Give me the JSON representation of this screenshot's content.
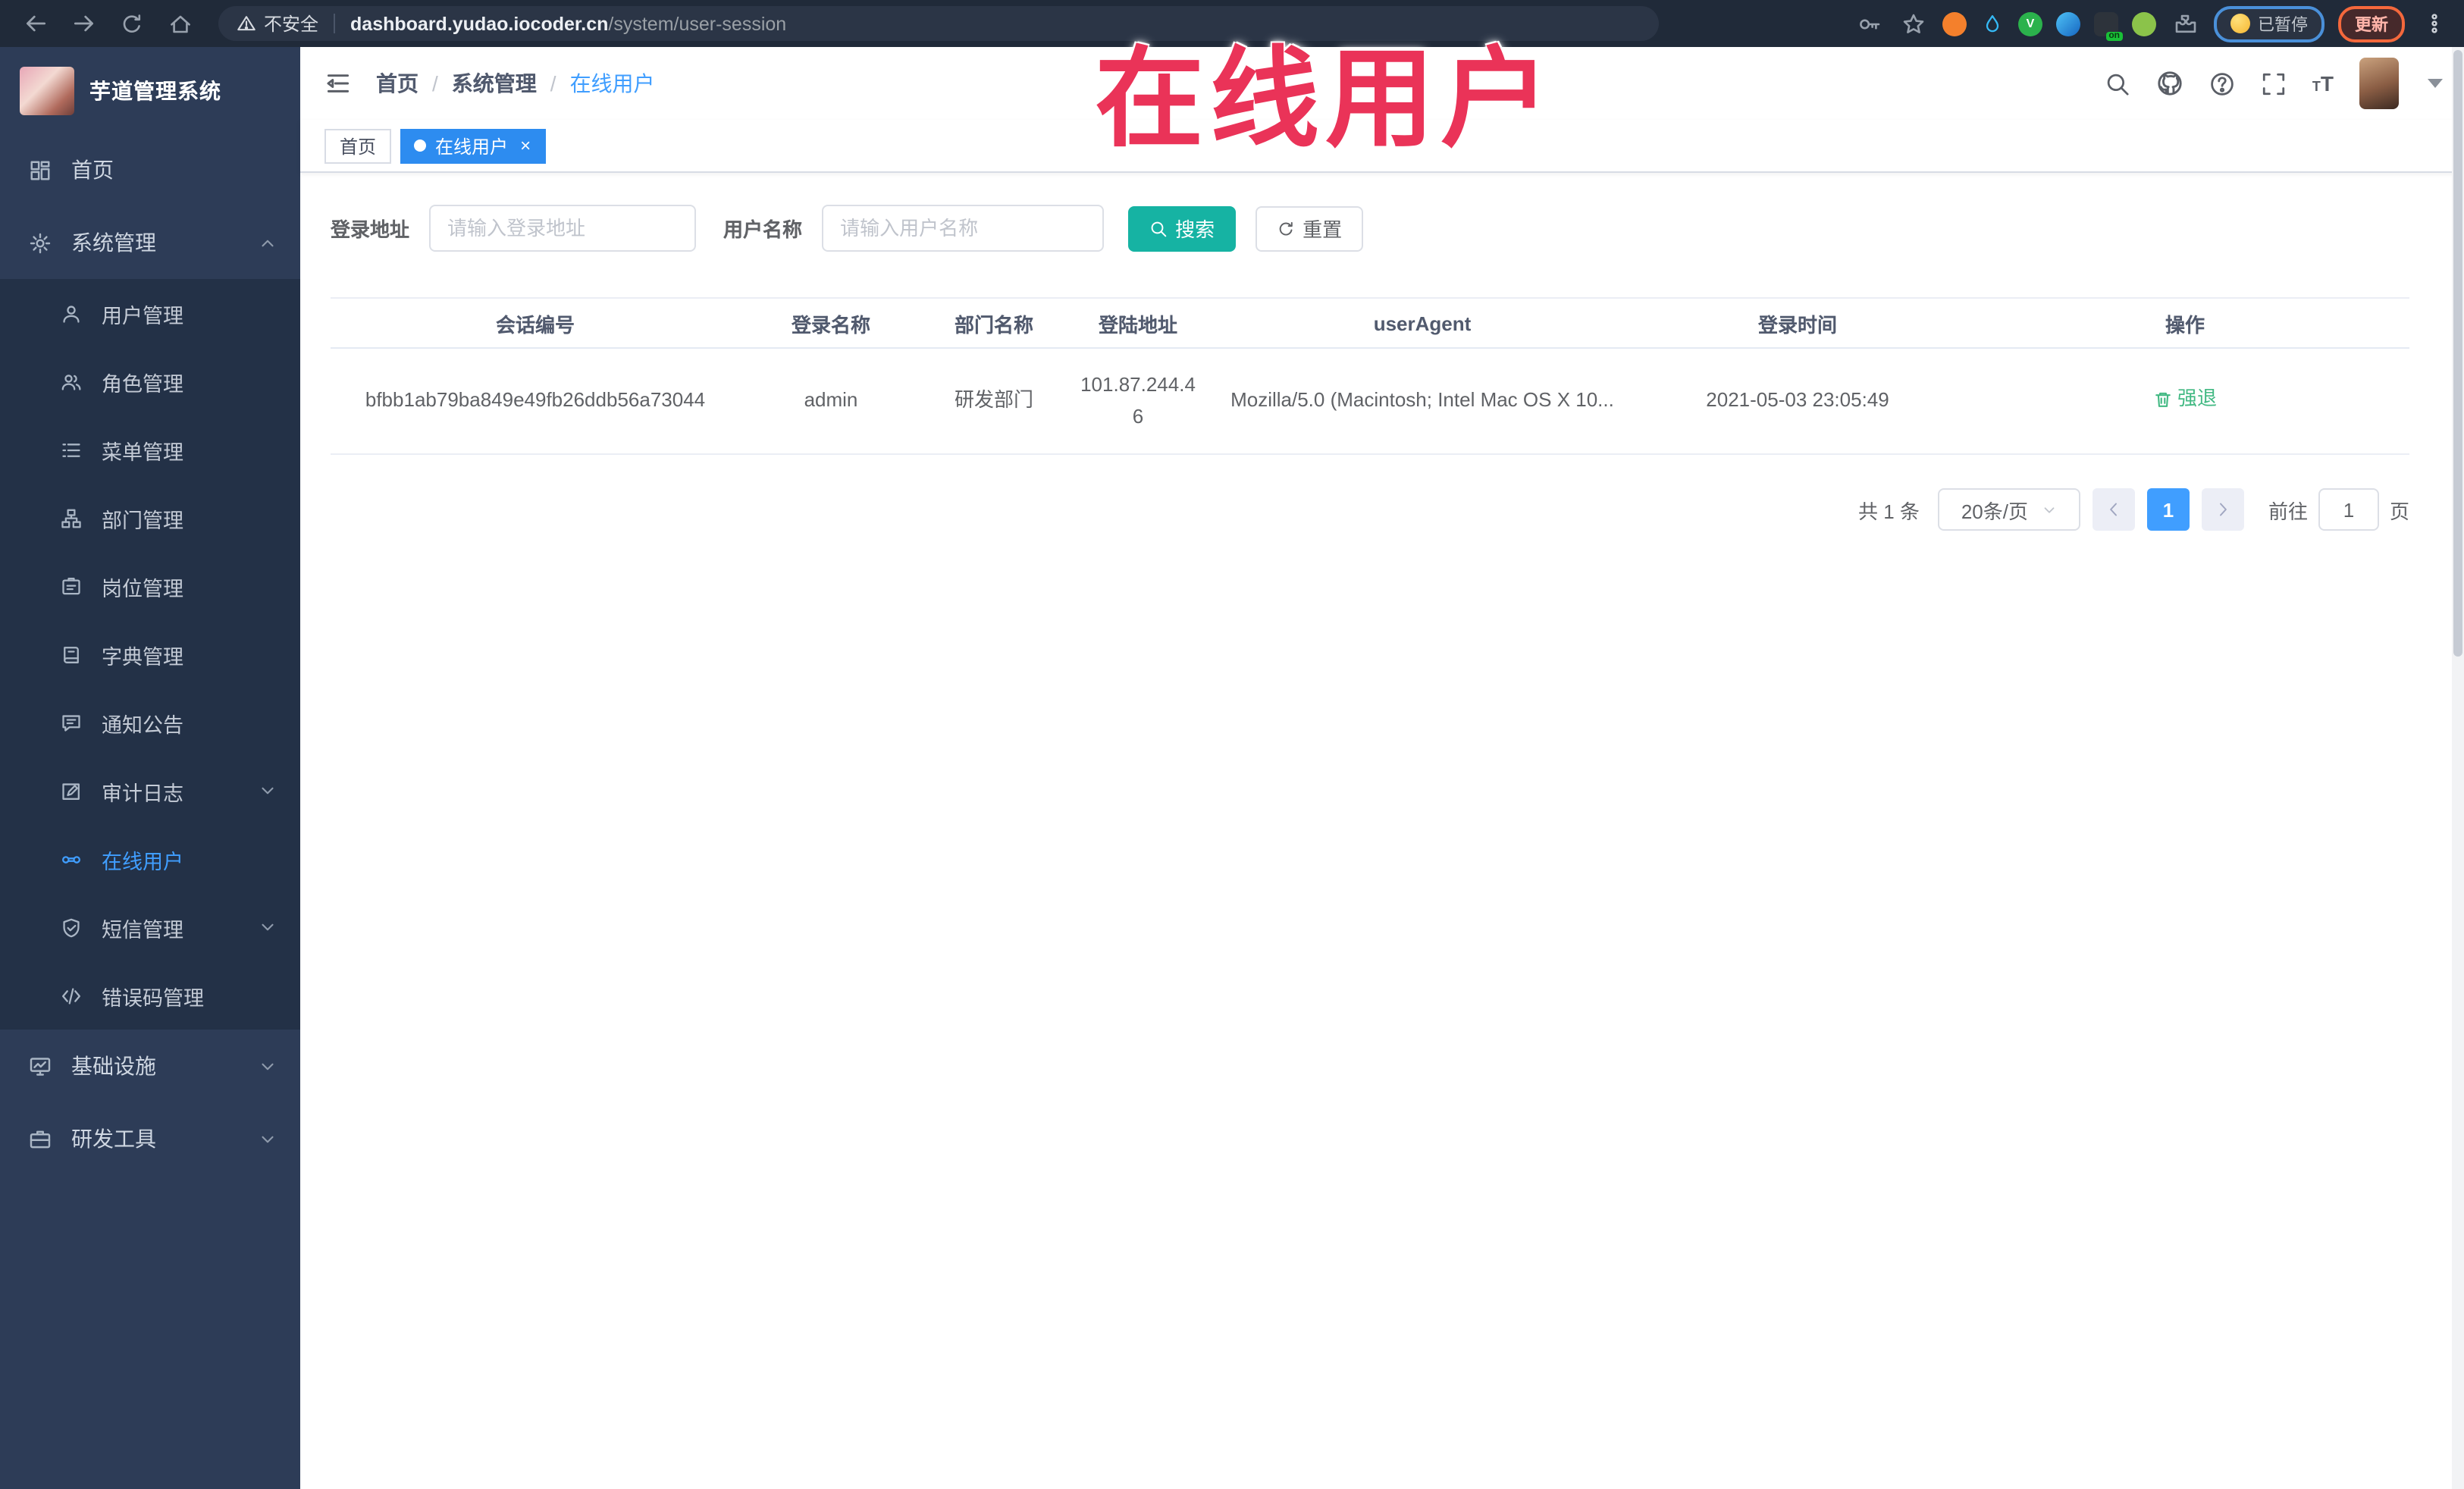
{
  "browser": {
    "security_label": "不安全",
    "url_domain": "dashboard.yudao.iocoder.cn",
    "url_path": "/system/user-session",
    "paused_badge_label": "已暂停",
    "update_button_label": "更新"
  },
  "sidebar": {
    "logo_title": "芋道管理系统",
    "items": [
      {
        "label": "首页"
      },
      {
        "label": "系统管理"
      }
    ],
    "submenu": [
      {
        "label": "用户管理"
      },
      {
        "label": "角色管理"
      },
      {
        "label": "菜单管理"
      },
      {
        "label": "部门管理"
      },
      {
        "label": "岗位管理"
      },
      {
        "label": "字典管理"
      },
      {
        "label": "通知公告"
      },
      {
        "label": "审计日志"
      },
      {
        "label": "在线用户"
      },
      {
        "label": "短信管理"
      },
      {
        "label": "错误码管理"
      }
    ],
    "bottom_items": [
      {
        "label": "基础设施"
      },
      {
        "label": "研发工具"
      }
    ]
  },
  "header": {
    "breadcrumb": [
      {
        "label": "首页"
      },
      {
        "label": "系统管理"
      },
      {
        "label": "在线用户"
      }
    ]
  },
  "tags_view": {
    "tabs": [
      {
        "label": "首页"
      },
      {
        "label": "在线用户"
      }
    ]
  },
  "overlay": {
    "title": "在线用户"
  },
  "filters": {
    "login_address_label": "登录地址",
    "login_address_placeholder": "请输入登录地址",
    "username_label": "用户名称",
    "username_placeholder": "请输入用户名称",
    "search_button_label": "搜索",
    "reset_button_label": "重置"
  },
  "table": {
    "headers": [
      "会话编号",
      "登录名称",
      "部门名称",
      "登陆地址",
      "userAgent",
      "登录时间",
      "操作"
    ],
    "rows": [
      {
        "session_id": "bfbb1ab79ba849e49fb26ddb56a73044",
        "login_name": "admin",
        "dept_name": "研发部门",
        "login_ip": "101.87.244.46",
        "user_agent": "Mozilla/5.0 (Macintosh; Intel Mac OS X 10...",
        "login_time": "2021-05-03 23:05:49",
        "action_label": "强退"
      }
    ]
  },
  "pagination": {
    "total_label": "共 1 条",
    "page_size_label": "20条/页",
    "current_page": "1",
    "goto_prefix": "前往",
    "goto_value": "1",
    "goto_suffix": "页"
  },
  "colors": {
    "accent_blue": "#409eff",
    "tab_active_blue": "#2d8cf0",
    "search_button_teal": "#16b3a3",
    "action_green": "#42b983",
    "overlay_red": "#ea3358",
    "sidebar_bg": "#2d3c57",
    "sidebar_submenu_bg": "#233147",
    "toolbar_bg": "#202a39"
  }
}
